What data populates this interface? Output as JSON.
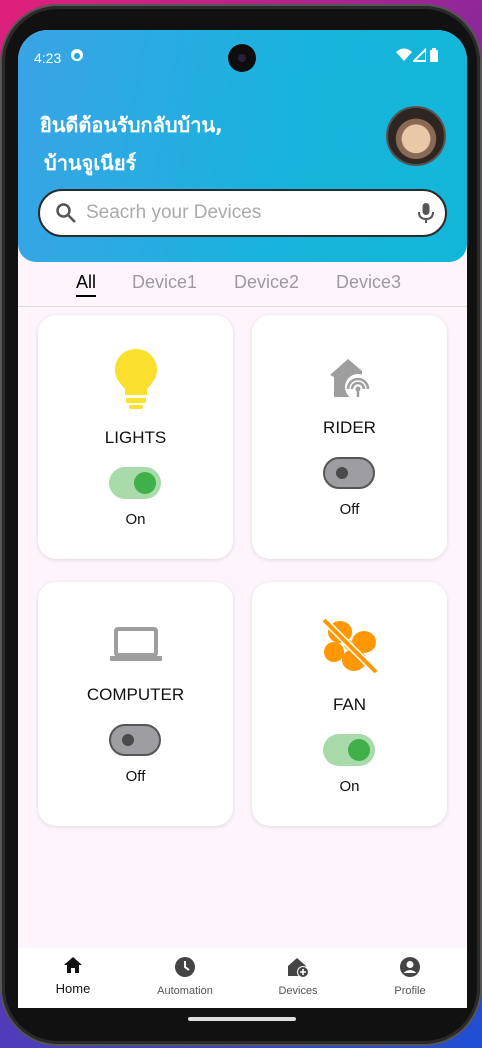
{
  "status": {
    "time": "4:23"
  },
  "header": {
    "greeting_line1": "ยินดีต้อนรับกลับบ้าน,",
    "greeting_line2": "บ้านจูเนียร์"
  },
  "search": {
    "placeholder": "Seacrh your Devices"
  },
  "tabs": [
    {
      "label": "All",
      "active": true
    },
    {
      "label": "Device1",
      "active": false
    },
    {
      "label": "Device2",
      "active": false
    },
    {
      "label": "Device3",
      "active": false
    }
  ],
  "devices": [
    {
      "name": "LIGHTS",
      "state": "On",
      "icon": "lightbulb-icon",
      "color": "#fbe12e",
      "on": true
    },
    {
      "name": "RIDER",
      "state": "Off",
      "icon": "home-wifi-icon",
      "color": "#9e9e9e",
      "on": false
    },
    {
      "name": "COMPUTER",
      "state": "Off",
      "icon": "laptop-icon",
      "color": "#9e9e9e",
      "on": false
    },
    {
      "name": "FAN",
      "state": "On",
      "icon": "fan-off-icon",
      "color": "#ff9800",
      "on": true
    }
  ],
  "nav": [
    {
      "label": "Home",
      "icon": "home-icon",
      "active": true
    },
    {
      "label": "Automation",
      "icon": "clock-icon",
      "active": false
    },
    {
      "label": "Devices",
      "icon": "add-home-icon",
      "active": false
    },
    {
      "label": "Profile",
      "icon": "account-icon",
      "active": false
    }
  ],
  "colors": {
    "header": "#18b4dd",
    "toggle_on": "#3fb04a",
    "toggle_off": "#9e9ea2"
  }
}
